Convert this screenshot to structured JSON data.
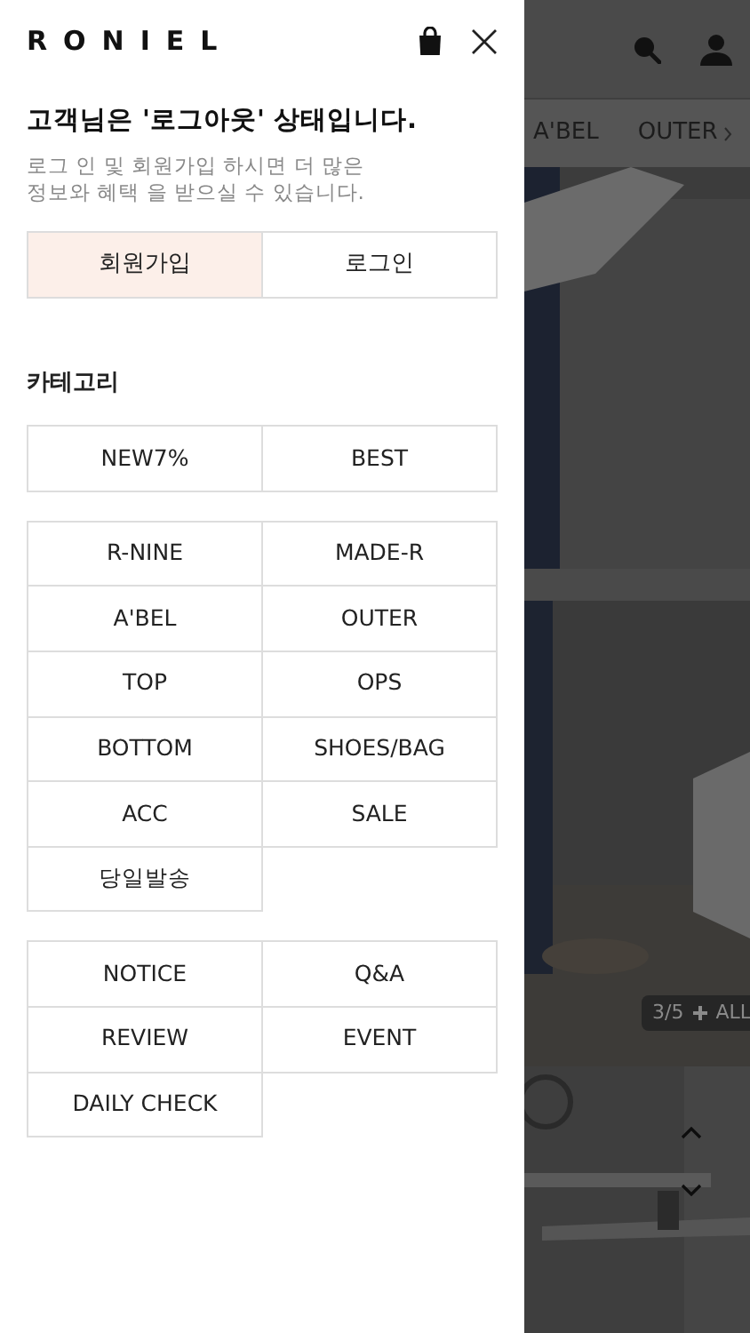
{
  "drawer": {
    "logo": "RONIEL",
    "notice": {
      "title": "고객님은 '로그아웃' 상태입니다.",
      "description_lines": [
        "로그 인 및 회원가입 하시면 더 많은",
        "정보와 혜택 을 받으실 수 있습니다."
      ]
    },
    "auth_buttons": [
      {
        "label": "회원가입",
        "selected": true
      },
      {
        "label": "로그인",
        "selected": false
      }
    ],
    "category_heading": "카테고리",
    "menu_groups": [
      [
        "NEW7%",
        "BEST"
      ],
      [
        "R-NINE",
        "MADE-R",
        "A'BEL",
        "OUTER",
        "TOP",
        "OPS",
        "BOTTOM",
        "SHOES/BAG",
        "ACC",
        "SALE",
        "당일발송"
      ],
      [
        "NOTICE",
        "Q&A",
        "REVIEW",
        "EVENT",
        "DAILY CHECK"
      ]
    ]
  },
  "background_page": {
    "category_tabs": [
      "A'BEL",
      "OUTER"
    ],
    "slide_counter": "3/5",
    "all_label": "ALL"
  }
}
